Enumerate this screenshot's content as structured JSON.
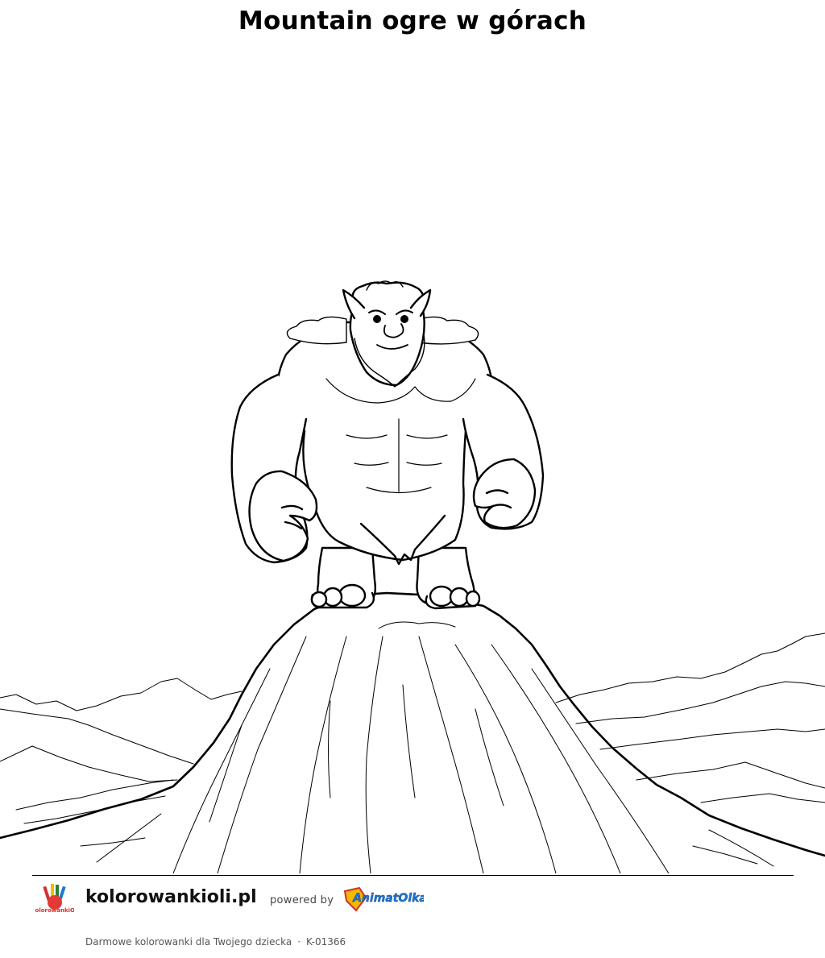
{
  "page": {
    "title": "Mountain ogre w górach"
  },
  "illustration": {
    "subject": "ogre-on-mountain-peak",
    "style": "black-line-art"
  },
  "footer": {
    "site_logo_text": "KolorowankiOli",
    "site_name": "kolorowankioli.pl",
    "powered_by": "powered by",
    "brand_logo_text": "AnimatOlka",
    "tagline": "Darmowe kolorowanki dla Twojego dziecka",
    "separator": "·",
    "code": "K-01366"
  },
  "colors": {
    "line": "#000000",
    "background": "#ffffff",
    "brand_blue": "#1e78d2",
    "brand_red": "#d32f2f",
    "brand_yellow": "#f5b800"
  }
}
